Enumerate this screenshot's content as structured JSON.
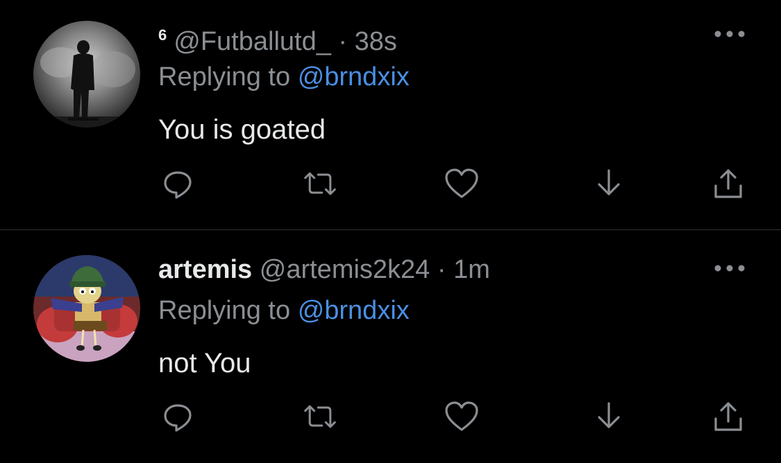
{
  "theme": {
    "background": "#000000",
    "text_primary": "#e7e9ea",
    "text_secondary": "#8b8f93",
    "link": "#4a8fe2",
    "divider": "#2f3336"
  },
  "tweets": [
    {
      "badge": "6",
      "display_name": "",
      "handle": "@Futballutd_",
      "separator": "·",
      "time": "38s",
      "replying_prefix": "Replying to",
      "replying_to": "@brndxix",
      "text": "You is goated",
      "avatar_icon": "silhouette-in-smoke-avatar",
      "actions": [
        "reply-icon",
        "retweet-icon",
        "like-icon",
        "save-icon",
        "share-icon"
      ]
    },
    {
      "badge": "",
      "display_name": "artemis",
      "handle": "@artemis2k24",
      "separator": "·",
      "time": "1m",
      "replying_prefix": "Replying to",
      "replying_to": "@brndxix",
      "text": "not You",
      "avatar_icon": "cartoon-character-avatar",
      "actions": [
        "reply-icon",
        "retweet-icon",
        "like-icon",
        "save-icon",
        "share-icon"
      ]
    }
  ]
}
